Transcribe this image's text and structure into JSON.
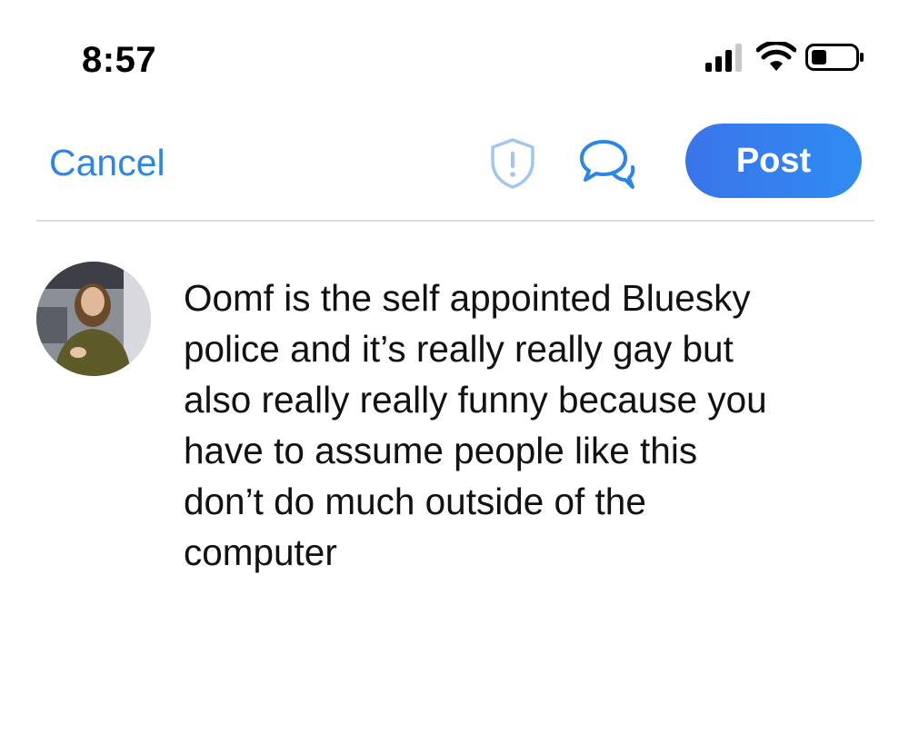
{
  "status_bar": {
    "time": "8:57",
    "icons": [
      "cellular-signal-icon",
      "wifi-icon",
      "battery-icon"
    ]
  },
  "header": {
    "cancel_label": "Cancel",
    "icons": [
      "shield-alert-icon",
      "chat-bubbles-icon"
    ],
    "post_label": "Post"
  },
  "composer": {
    "avatar": "avatar",
    "text": "Oomf is the self appointed Bluesky\npolice and it’s really really gay but\nalso really really funny because you\nhave to assume people like this\ndon’t do much outside of the\ncomputer"
  },
  "colors": {
    "accent": "#2b86e6",
    "post_button": "#3b74ea",
    "divider": "#dcdfe4",
    "text": "#111111"
  }
}
